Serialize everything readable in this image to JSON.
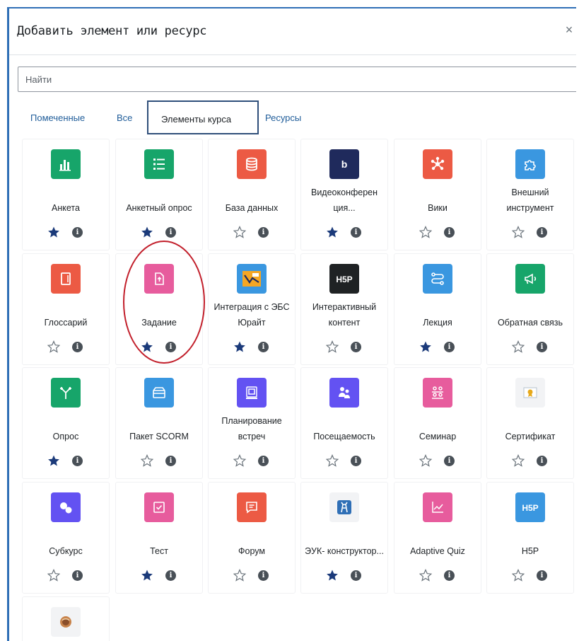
{
  "dialog": {
    "title": "Добавить элемент или ресурс",
    "close": "×"
  },
  "search": {
    "placeholder": "Найти",
    "value": ""
  },
  "tabs": [
    {
      "label": "Помеченные",
      "active": false
    },
    {
      "label": "Все",
      "active": false
    },
    {
      "label": "Элементы курса",
      "active": true
    },
    {
      "label": "Ресурсы",
      "active": false
    }
  ],
  "info_glyph": "i",
  "items": [
    {
      "name": "Анкета",
      "icon": "bar-chart-icon",
      "color": "#17a56a",
      "starred": true
    },
    {
      "name": "Анкетный опрос",
      "icon": "list-icon",
      "color": "#17a56a",
      "starred": true
    },
    {
      "name": "База данных",
      "icon": "database-icon",
      "color": "#ec5a44",
      "starred": false
    },
    {
      "name": "Видеоконферен ция...",
      "icon": "bigbluebutton-icon",
      "color": "#1f2a5c",
      "starred": true
    },
    {
      "name": "Вики",
      "icon": "wiki-icon",
      "color": "#ec5a44",
      "starred": false
    },
    {
      "name": "Внешний инструмент",
      "icon": "puzzle-icon",
      "color": "#3a97e0",
      "starred": false
    },
    {
      "name": "Глоссарий",
      "icon": "glossary-icon",
      "color": "#ec5a44",
      "starred": false
    },
    {
      "name": "Задание",
      "icon": "assignment-icon",
      "color": "#e75c9d",
      "starred": true
    },
    {
      "name": "Интеграция с ЭБС Юрайт",
      "icon": "urait-icon",
      "color": "#3a97e0",
      "starred": true
    },
    {
      "name": "Интерактивный контент",
      "icon": "h5p-icon",
      "color": "#1f2224",
      "starred": false
    },
    {
      "name": "Лекция",
      "icon": "lesson-icon",
      "color": "#3a97e0",
      "starred": true
    },
    {
      "name": "Обратная связь",
      "icon": "megaphone-icon",
      "color": "#17a56a",
      "starred": false
    },
    {
      "name": "Опрос",
      "icon": "choice-icon",
      "color": "#17a56a",
      "starred": true
    },
    {
      "name": "Пакет SCORM",
      "icon": "package-icon",
      "color": "#3a97e0",
      "starred": false
    },
    {
      "name": "Планирование встреч",
      "icon": "scheduler-icon",
      "color": "#6352f2",
      "starred": false
    },
    {
      "name": "Посещаемость",
      "icon": "attendance-icon",
      "color": "#6352f2",
      "starred": false
    },
    {
      "name": "Семинар",
      "icon": "workshop-icon",
      "color": "#e75c9d",
      "starred": false
    },
    {
      "name": "Сертификат",
      "icon": "certificate-icon",
      "color": "#f2f3f5",
      "starred": false
    },
    {
      "name": "Субкурс",
      "icon": "subcourse-icon",
      "color": "#6352f2",
      "starred": false
    },
    {
      "name": "Тест",
      "icon": "quiz-icon",
      "color": "#e75c9d",
      "starred": true
    },
    {
      "name": "Форум",
      "icon": "forum-icon",
      "color": "#ec5a44",
      "starred": false
    },
    {
      "name": "ЭУК- конструктор...",
      "icon": "deer-icon",
      "color": "#f2f3f5",
      "starred": true
    },
    {
      "name": "Adaptive Quiz",
      "icon": "line-chart-icon",
      "color": "#e75c9d",
      "starred": false
    },
    {
      "name": "H5P",
      "icon": "h5p-icon",
      "color": "#3a97e0",
      "starred": false
    },
    {
      "name": "",
      "icon": "glove-icon",
      "color": "#f2f3f5",
      "starred": false
    }
  ]
}
